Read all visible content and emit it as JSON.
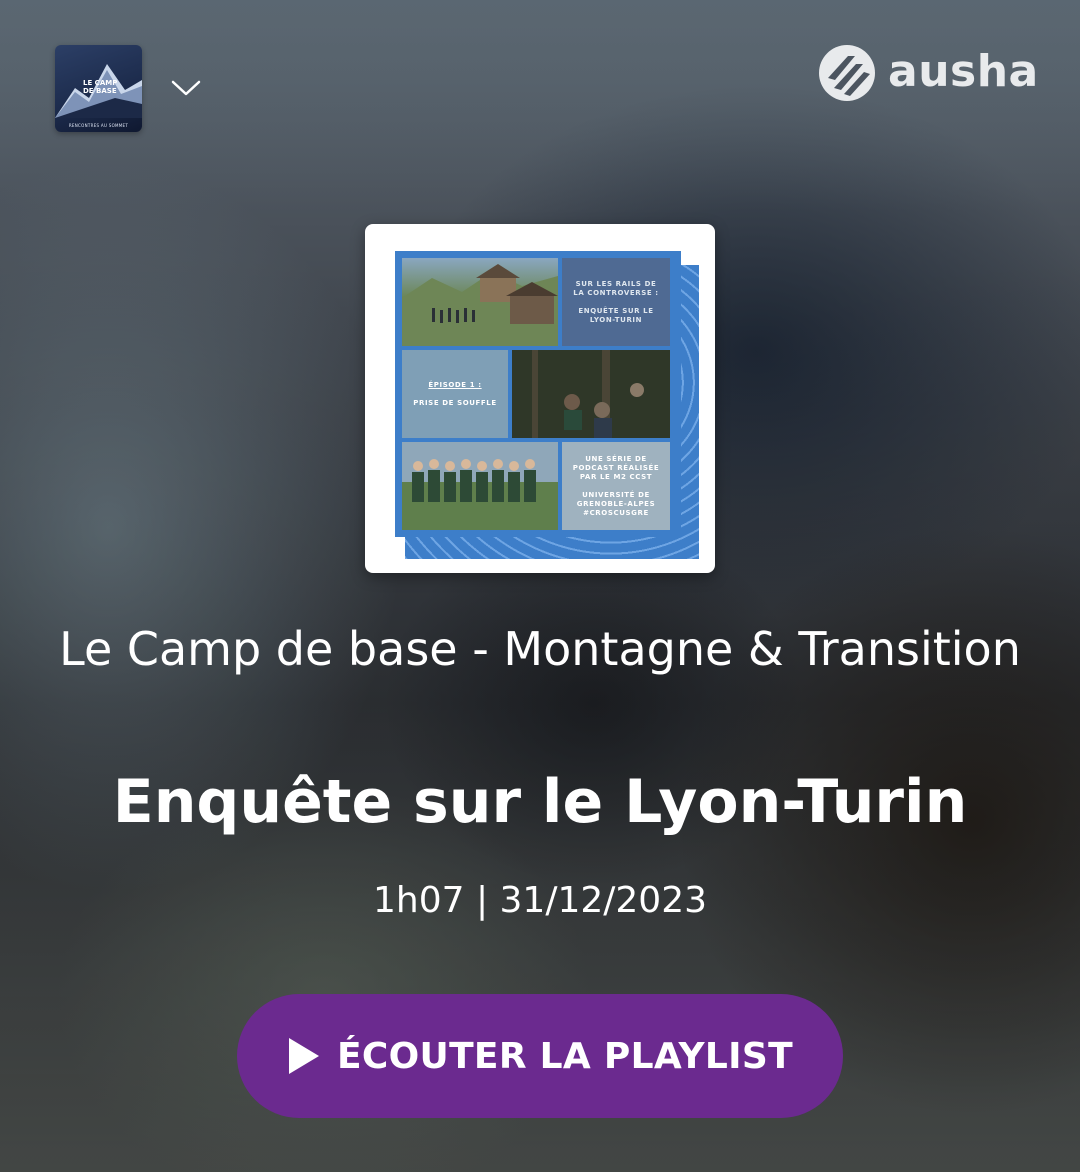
{
  "header": {
    "show_thumbnail": {
      "line1": "LE CAMP",
      "line2": "DE BASE",
      "tagline": "RENCONTRES AU SOMMET"
    },
    "dropdown_icon": "chevron-down-icon",
    "brand": {
      "name": "ausha",
      "logo_icon": "ausha-logo-icon"
    }
  },
  "cover": {
    "text_top": [
      "SUR LES RAILS DE",
      "LA CONTROVERSE :",
      "",
      "ENQUÊTE SUR LE",
      "LYON-TURIN"
    ],
    "text_middle": [
      "ÉPISODE 1 :",
      "",
      "PRISE DE SOUFFLE"
    ],
    "text_bottom": [
      "UNE SÉRIE DE",
      "PODCAST RÉALISÉE",
      "PAR LE M2 CCST",
      "",
      "UNIVERSITÉ DE",
      "GRENOBLE-ALPES",
      "#CROSCUSGRE"
    ]
  },
  "show_title": "Le Camp de base - Montagne & Transition",
  "episode_title": "Enquête sur le Lyon-Turin",
  "meta": "1h07 | 31/12/2023",
  "play_button": {
    "label": "ÉCOUTER LA PLAYLIST",
    "icon": "play-icon"
  },
  "colors": {
    "button": "#6b2a8f",
    "cover_blue": "#3d7ec9"
  }
}
